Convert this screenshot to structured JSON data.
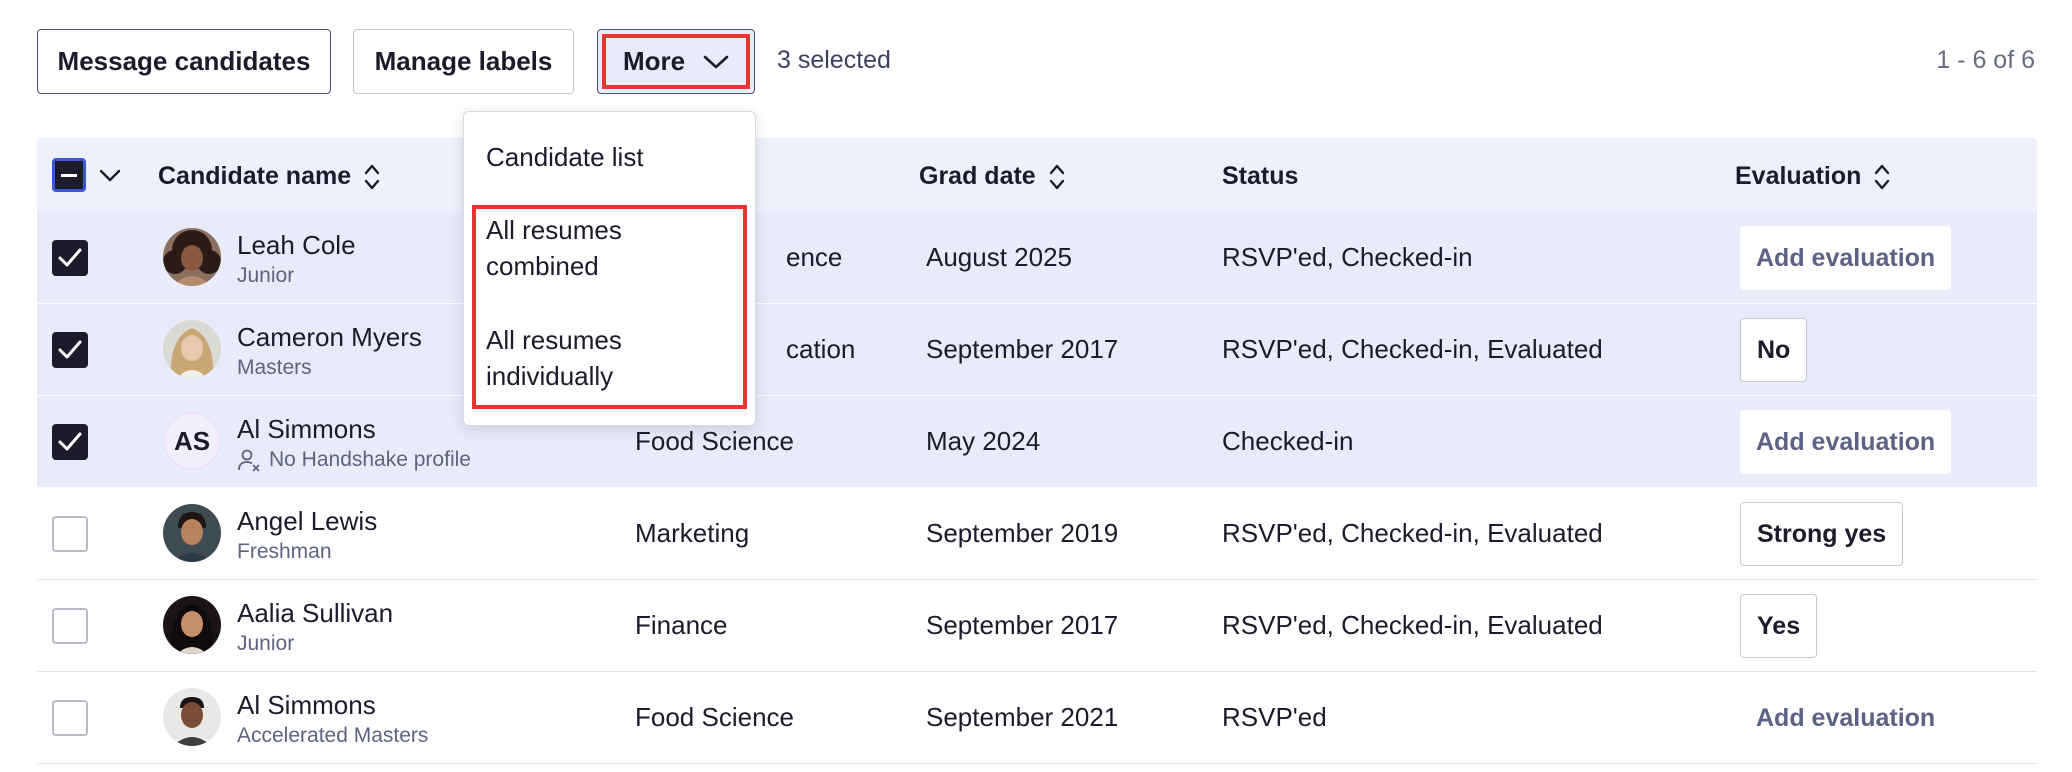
{
  "toolbar": {
    "message_label": "Message candidates",
    "manage_labels_label": "Manage labels",
    "more_label": "More",
    "selected_count": "3 selected",
    "pagination": "1 - 6 of 6"
  },
  "dropdown": {
    "items": [
      "Candidate list",
      "All resumes combined",
      "All resumes individually"
    ],
    "item_lines": [
      [
        "Candidate list"
      ],
      [
        "All resumes",
        "combined"
      ],
      [
        "All resumes",
        "individually"
      ]
    ]
  },
  "table": {
    "headers": {
      "name": "Candidate name",
      "grad": "Grad date",
      "status": "Status",
      "evaluation": "Evaluation"
    },
    "rows": [
      {
        "name": "Leah Cole",
        "sub": "Junior",
        "major": "ence",
        "grad": "August 2025",
        "status": "RSVP'ed, Checked-in",
        "evaluation": "Add evaluation",
        "selected": true
      },
      {
        "name": "Cameron Myers",
        "sub": "Masters",
        "major": "cation",
        "grad": "September 2017",
        "status": "RSVP'ed, Checked-in, Evaluated",
        "evaluation": "No",
        "selected": true
      },
      {
        "name": "Al Simmons",
        "sub": "No Handshake profile",
        "initials": "AS",
        "major": "Food Science",
        "grad": "May 2024",
        "status": "Checked-in",
        "evaluation": "Add evaluation",
        "selected": true
      },
      {
        "name": "Angel Lewis",
        "sub": "Freshman",
        "major": "Marketing",
        "grad": "September 2019",
        "status": "RSVP'ed, Checked-in, Evaluated",
        "evaluation": "Strong yes",
        "selected": false
      },
      {
        "name": "Aalia Sullivan",
        "sub": "Junior",
        "major": "Finance",
        "grad": "September 2017",
        "status": "RSVP'ed, Checked-in, Evaluated",
        "evaluation": "Yes",
        "selected": false
      },
      {
        "name": "Al Simmons",
        "sub": "Accelerated Masters",
        "major": "Food Science",
        "grad": "September 2021",
        "status": "RSVP'ed",
        "evaluation": "Add evaluation",
        "selected": false
      }
    ]
  },
  "colors": {
    "accent": "#3b55d6",
    "selected_row_bg": "#e8ebfa",
    "highlight_red": "#e53530",
    "header_bg": "#eef1fb"
  },
  "icons": {
    "more_chevron": "chevron-down-icon",
    "sort": "sort-icon",
    "no_profile": "user-x-icon"
  }
}
